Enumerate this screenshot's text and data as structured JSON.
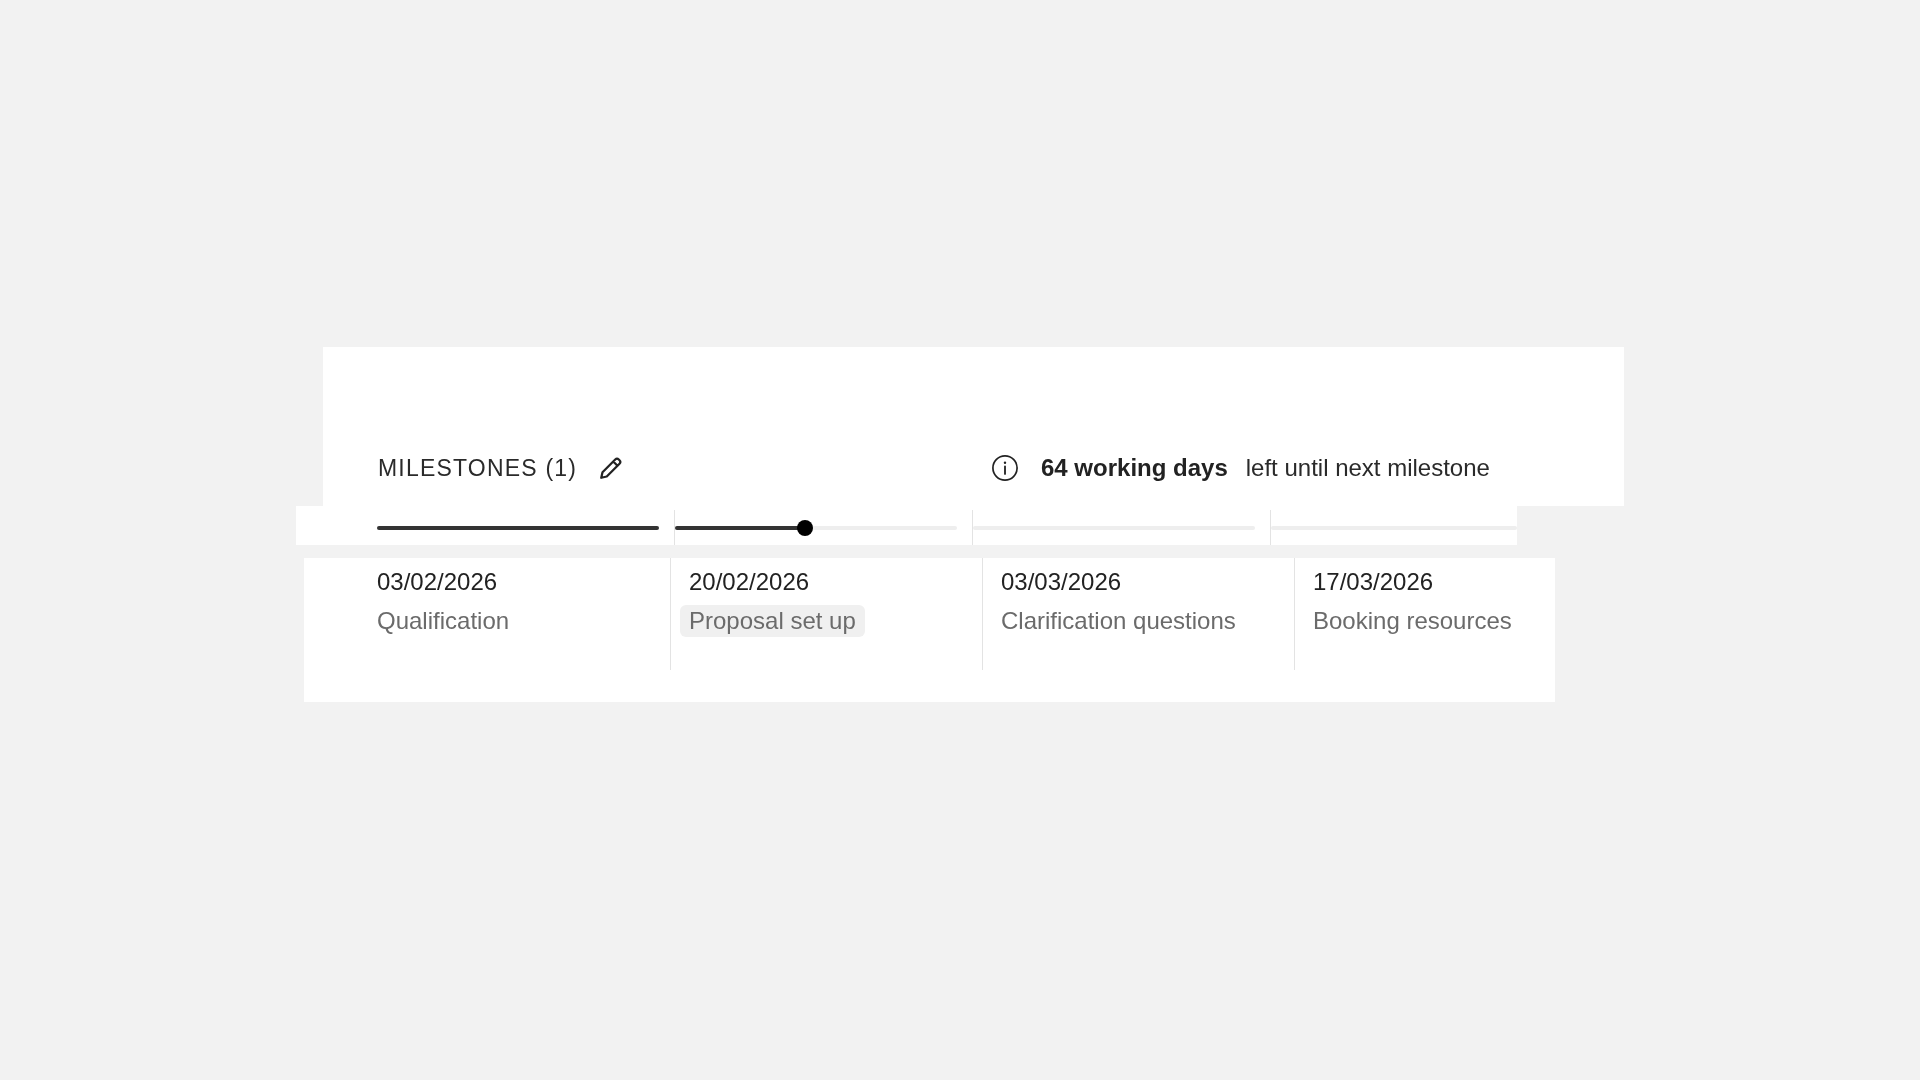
{
  "header": {
    "title": "MILESTONES (1)",
    "info": {
      "highlight": "64 working days",
      "text": "left until next milestone"
    }
  },
  "milestones": [
    {
      "date": "03/02/2026",
      "name": "Qualification",
      "selected": false,
      "level": 1
    },
    {
      "date": "20/02/2026",
      "name": "Proposal set up",
      "selected": true,
      "level": 0.46
    },
    {
      "date": "03/03/2026",
      "name": "Clarification questions",
      "selected": false
    },
    {
      "date": "17/03/2026",
      "name": "Booking resources",
      "selected": false
    }
  ]
}
